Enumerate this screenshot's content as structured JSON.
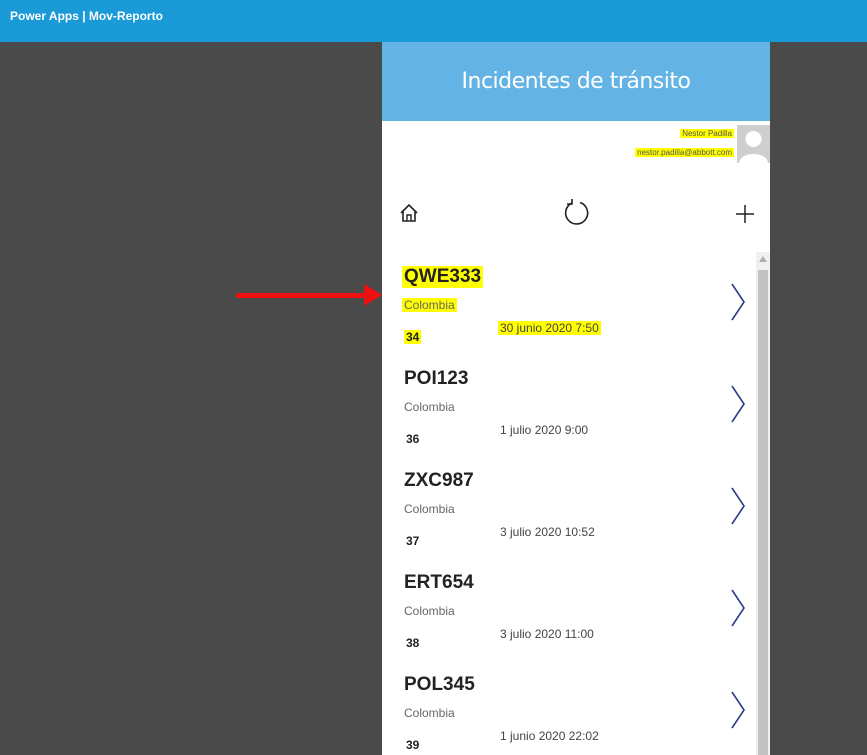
{
  "window": {
    "title": "Power Apps | Mov-Reporto"
  },
  "app": {
    "title": "Incidentes de tránsito",
    "user": {
      "name": "Nestor Padilla",
      "email": "nestor.padilla@abbott.com"
    },
    "toolbar": {
      "home_icon": "home-icon",
      "refresh_icon": "refresh-icon",
      "add_icon": "plus-icon"
    }
  },
  "colors": {
    "topbar": "#1a9ad6",
    "header": "#63b3e4",
    "highlight": "#ffff00",
    "annotation_arrow": "#ee1111"
  },
  "items": [
    {
      "plate": "QWE333",
      "country": "Colombia",
      "number": "34",
      "date": "30 junio 2020 7:50"
    },
    {
      "plate": "POI123",
      "country": "Colombia",
      "number": "36",
      "date": "1 julio 2020 9:00"
    },
    {
      "plate": "ZXC987",
      "country": "Colombia",
      "number": "37",
      "date": "3 julio 2020 10:52"
    },
    {
      "plate": "ERT654",
      "country": "Colombia",
      "number": "38",
      "date": "3 julio 2020 11:00"
    },
    {
      "plate": "POL345",
      "country": "Colombia",
      "number": "39",
      "date": "1 junio 2020 22:02"
    }
  ]
}
